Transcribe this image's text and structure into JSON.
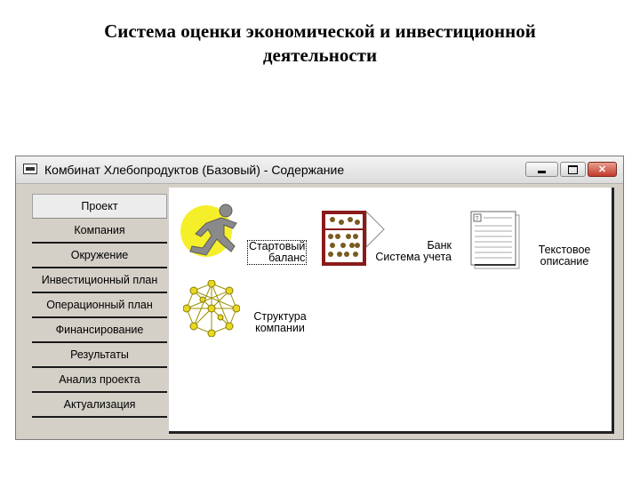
{
  "slide": {
    "title_line1": "Система оценки экономической и инвестиционной",
    "title_line2": "деятельности"
  },
  "window": {
    "title": "Комбинат Хлебопродуктов (Базовый) - Содержание",
    "buttons": {
      "minimize": "minimize",
      "maximize": "maximize",
      "close": "close"
    }
  },
  "nav": {
    "items": [
      {
        "label": "Проект"
      },
      {
        "label": "Компания"
      },
      {
        "label": "Окружение"
      },
      {
        "label": "Инвестиционный план"
      },
      {
        "label": "Операционный план"
      },
      {
        "label": "Финансирование"
      },
      {
        "label": "Результаты"
      },
      {
        "label": "Анализ проекта"
      },
      {
        "label": "Актуализация"
      }
    ]
  },
  "icons": {
    "start_balance": {
      "line1": "Стартовый",
      "line2": "баланс",
      "icon": "runner-icon"
    },
    "accounting_bank": {
      "line1": "Банк",
      "line2": "Система учета",
      "icon": "abacus-icon"
    },
    "text_description": {
      "line1": "Текстовое",
      "line2": "описание",
      "icon": "document-icon"
    },
    "company_structure": {
      "line1": "Структура",
      "line2": "компании",
      "icon": "network-icon"
    }
  },
  "colors": {
    "window_bg": "#d4d0c8",
    "close_button": "#c0392b",
    "runner_circle": "#f5ef2a",
    "abacus_frame": "#8b1a1a"
  }
}
